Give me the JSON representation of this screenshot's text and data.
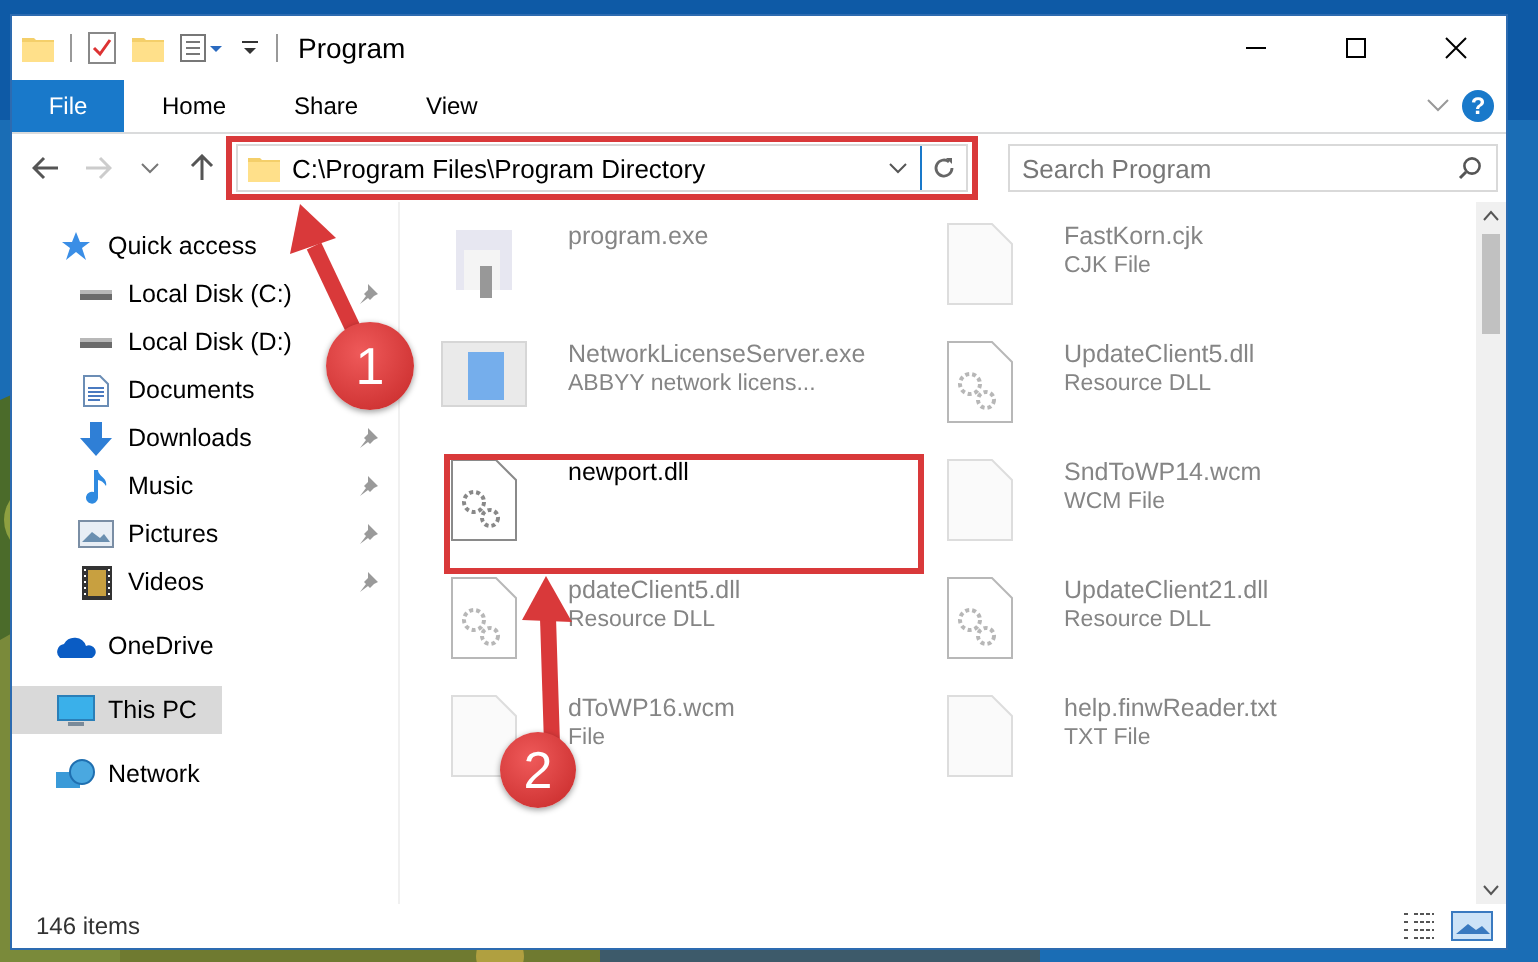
{
  "window": {
    "title": "Program"
  },
  "ribbon": {
    "file_button": "File",
    "tabs": [
      "Home",
      "Share",
      "View"
    ],
    "help": "?"
  },
  "address": {
    "path": "C:\\Program Files\\Program Directory"
  },
  "search": {
    "placeholder": "Search Program"
  },
  "sidebar": {
    "items": [
      {
        "label": "Quick access",
        "kind": "star",
        "selected": false,
        "children": [
          {
            "label": "Local Disk (C:)",
            "kind": "drive",
            "pinned": true,
            "selected": false
          },
          {
            "label": "Local Disk (D:)",
            "kind": "drive",
            "selected": false
          },
          {
            "label": "Documents",
            "kind": "docs",
            "selected": false
          },
          {
            "label": "Downloads",
            "kind": "download",
            "pinned": true,
            "selected": false
          },
          {
            "label": "Music",
            "kind": "music",
            "pinned": true,
            "selected": false
          },
          {
            "label": "Pictures",
            "kind": "pictures",
            "pinned": true,
            "selected": false
          },
          {
            "label": "Videos",
            "kind": "videos",
            "pinned": true,
            "selected": false
          }
        ]
      },
      {
        "label": "OneDrive",
        "kind": "cloud",
        "selected": false
      },
      {
        "label": "This PC",
        "kind": "pc",
        "selected": true
      },
      {
        "label": "Network",
        "kind": "network",
        "selected": false
      }
    ]
  },
  "files": [
    {
      "name": "program.exe",
      "kind": "exe",
      "blurred": true
    },
    {
      "name": "FastKorn.cjk",
      "type": "CJK File",
      "kind": "file",
      "blurred": true
    },
    {
      "name": "NetworkLicenseServer.exe",
      "type": "ABBYY network licens...",
      "kind": "app",
      "blurred": true
    },
    {
      "name": "UpdateClient5.dll",
      "type": "Resource DLL",
      "kind": "dll",
      "blurred": true
    },
    {
      "name": "newport.dll",
      "kind": "dll",
      "blurred": false
    },
    {
      "name": "SndToWP14.wcm",
      "type": "WCM File",
      "kind": "file",
      "blurred": true
    },
    {
      "name": "pdateClient5.dll",
      "type": "Resource DLL",
      "kind": "dll",
      "blurred": true
    },
    {
      "name": "UpdateClient21.dll",
      "type": "Resource DLL",
      "kind": "dll",
      "blurred": true
    },
    {
      "name": "dToWP16.wcm",
      "type": "File",
      "kind": "file",
      "blurred": true
    },
    {
      "name": "help.finwReader.txt",
      "type": "TXT File",
      "kind": "file",
      "blurred": true
    }
  ],
  "status_bar": {
    "count": "146 items"
  },
  "annotations": [
    {
      "number": "1"
    },
    {
      "number": "2"
    }
  ]
}
